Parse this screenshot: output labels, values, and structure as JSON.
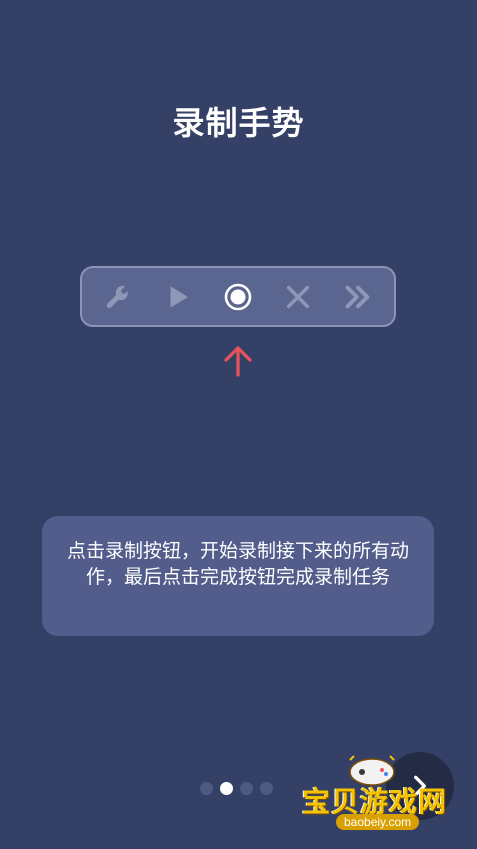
{
  "page": {
    "title": "录制手势",
    "description": "点击录制按钮，开始录制接下来的所有动作，最后点击完成按钮完成录制任务"
  },
  "toolbar": {
    "items": [
      {
        "icon": "wrench-icon"
      },
      {
        "icon": "play-icon"
      },
      {
        "icon": "record-icon"
      },
      {
        "icon": "close-icon"
      },
      {
        "icon": "double-chevron-right-icon"
      }
    ]
  },
  "pager": {
    "total": 4,
    "current": 2
  },
  "colors": {
    "background": "#344066",
    "toolbar": "#5a6690",
    "card": "#525d8c",
    "arrow": "#e8545a"
  },
  "watermark": {
    "text": "宝贝游戏网",
    "url": "baobeiy.com"
  }
}
